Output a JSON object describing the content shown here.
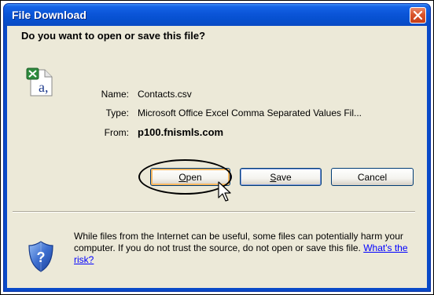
{
  "window": {
    "title": "File Download"
  },
  "dialog": {
    "question": "Do you want to open or save this file?",
    "file_icon": "csv-file-icon",
    "fields": {
      "name_label": "Name:",
      "name_value": "Contacts.csv",
      "type_label": "Type:",
      "type_value": "Microsoft Office Excel Comma Separated Values Fil...",
      "from_label": "From:",
      "from_value": "p100.fnismls.com"
    },
    "buttons": {
      "open": {
        "mnemonic": "O",
        "rest": "pen"
      },
      "save": {
        "mnemonic": "S",
        "rest": "ave"
      },
      "cancel": "Cancel"
    },
    "warning": {
      "text": "While files from the Internet can be useful, some files can potentially harm your computer. If you do not trust the source, do not open or save this file.",
      "link": "What's the risk?",
      "icon": "security-shield-icon"
    }
  },
  "colors": {
    "titlebar": "#0a4ac8",
    "face": "#ece9d8",
    "close": "#d9542a",
    "default_button_ring": "#f8b860",
    "link": "#0000ff"
  }
}
